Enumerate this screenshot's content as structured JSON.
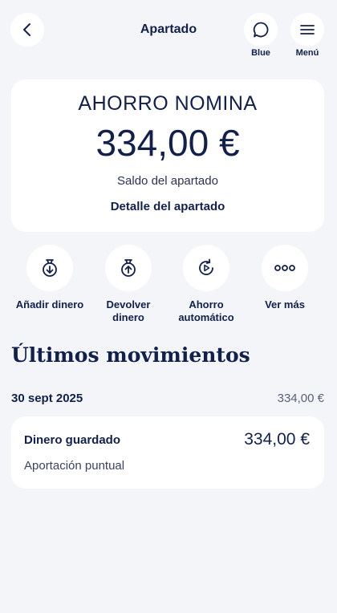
{
  "header": {
    "title": "Apartado",
    "back_icon": "chevron-left-icon",
    "blue_label": "Blue",
    "menu_label": "Menú"
  },
  "balance": {
    "account_name": "AHORRO NOMINA",
    "amount": "334,00 €",
    "caption": "Saldo del apartado",
    "detail_link": "Detalle del apartado"
  },
  "actions": [
    {
      "label": "Añadir dinero",
      "icon": "add-money-icon"
    },
    {
      "label": "Devolver\ndinero",
      "icon": "return-money-icon"
    },
    {
      "label": "Ahorro\nautomático",
      "icon": "auto-save-icon"
    },
    {
      "label": "Ver más",
      "icon": "more-dots-icon"
    }
  ],
  "movements": {
    "section_title": "Últimos movimientos",
    "groups": [
      {
        "date": "30 sept 2025",
        "total": "334,00 €",
        "items": [
          {
            "title": "Dinero guardado",
            "amount": "334,00 €",
            "subtitle": "Aportación puntual"
          }
        ]
      }
    ]
  },
  "colors": {
    "background": "#f3f5f8",
    "card": "#ffffff",
    "primary_text": "#12204a"
  }
}
